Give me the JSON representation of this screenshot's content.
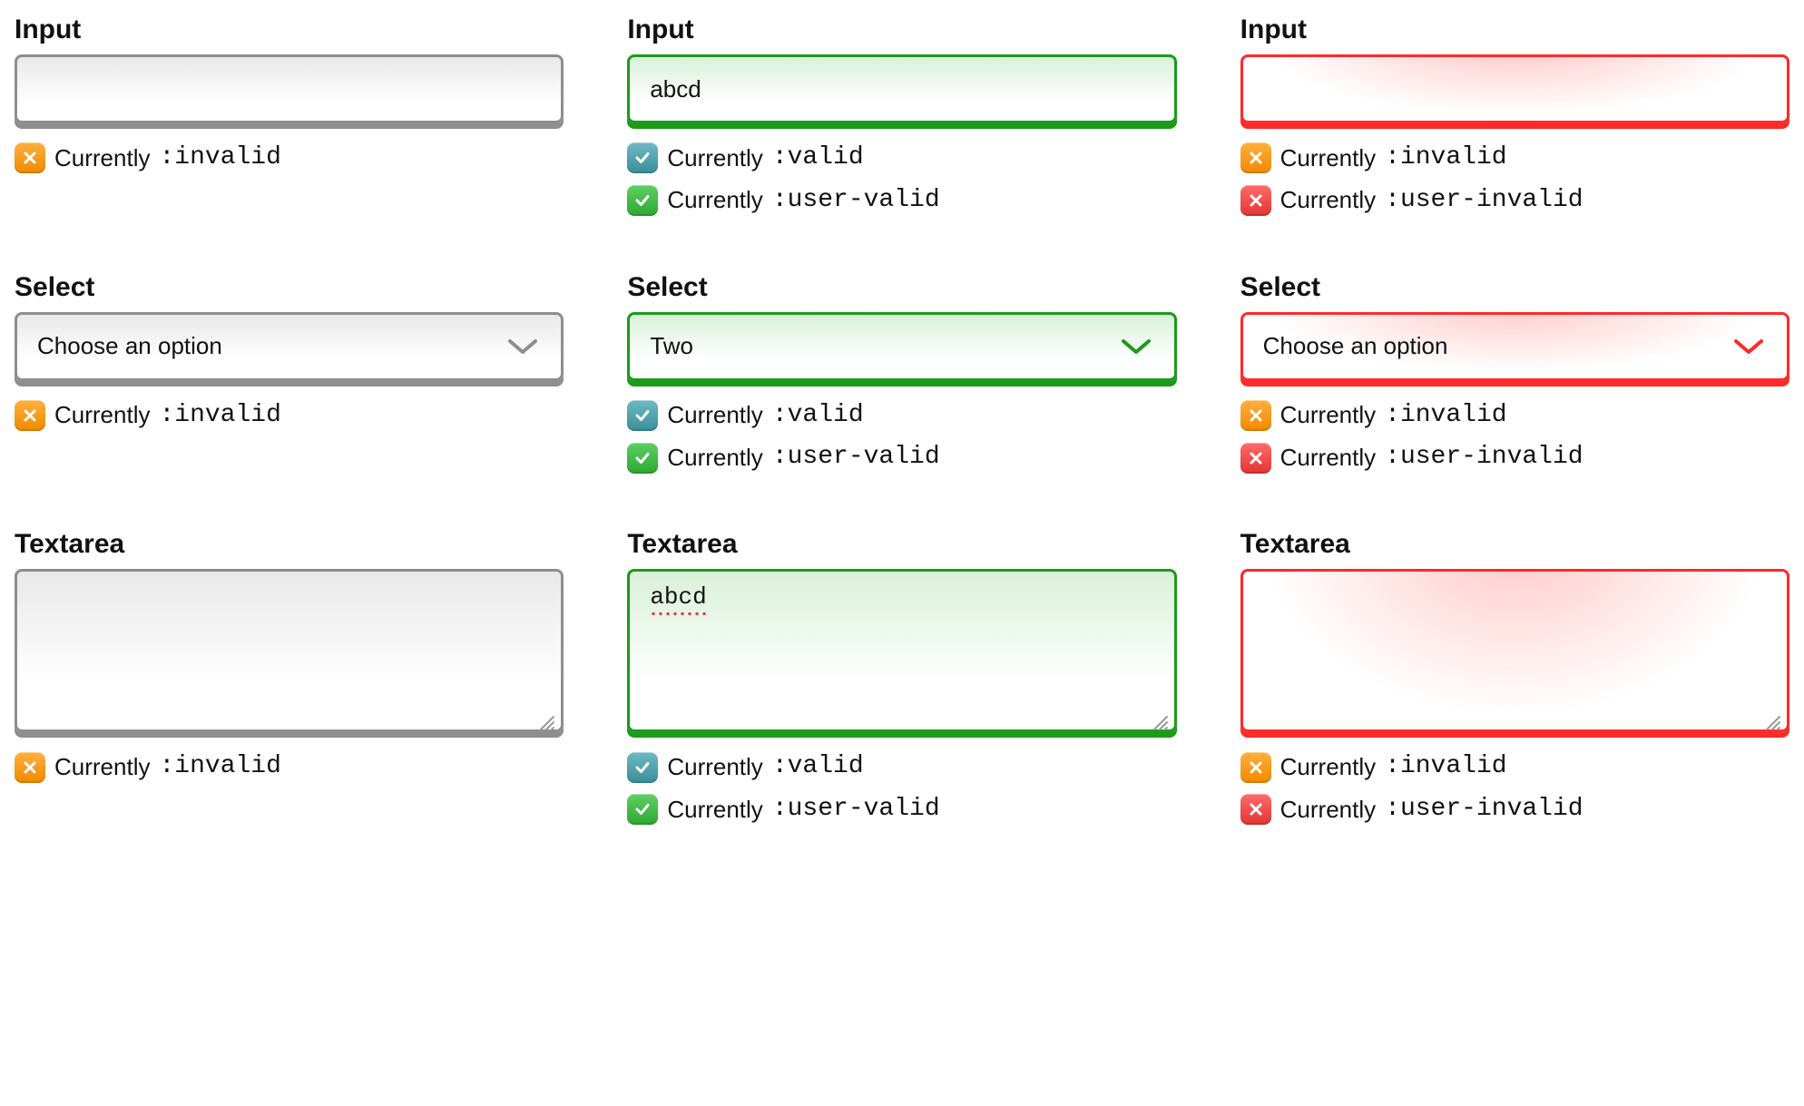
{
  "labels": {
    "input": "Input",
    "select": "Select",
    "textarea": "Textarea"
  },
  "status_prefix": "Currently",
  "pseudo": {
    "invalid": ":invalid",
    "valid": ":valid",
    "user_valid": ":user-valid",
    "user_invalid": ":user-invalid"
  },
  "icons": {
    "orange_x": "x-orange-icon",
    "teal_check": "check-teal-icon",
    "green_check": "check-green-icon",
    "red_x": "x-red-icon"
  },
  "colors": {
    "gray": "#8e8e8e",
    "green": "#1a9b1a",
    "red": "#ff2a2a"
  },
  "cells": [
    {
      "kind": "input",
      "tone": "gray",
      "value": "",
      "statuses": [
        {
          "icon": "orange_x",
          "pseudo": "invalid"
        }
      ]
    },
    {
      "kind": "input",
      "tone": "green",
      "value": "abcd",
      "statuses": [
        {
          "icon": "teal_check",
          "pseudo": "valid"
        },
        {
          "icon": "green_check",
          "pseudo": "user_valid"
        }
      ]
    },
    {
      "kind": "input",
      "tone": "red",
      "value": "",
      "statuses": [
        {
          "icon": "orange_x",
          "pseudo": "invalid"
        },
        {
          "icon": "red_x",
          "pseudo": "user_invalid"
        }
      ]
    },
    {
      "kind": "select",
      "tone": "gray",
      "value": "Choose an option",
      "statuses": [
        {
          "icon": "orange_x",
          "pseudo": "invalid"
        }
      ]
    },
    {
      "kind": "select",
      "tone": "green",
      "value": "Two",
      "statuses": [
        {
          "icon": "teal_check",
          "pseudo": "valid"
        },
        {
          "icon": "green_check",
          "pseudo": "user_valid"
        }
      ]
    },
    {
      "kind": "select",
      "tone": "red",
      "value": "Choose an option",
      "statuses": [
        {
          "icon": "orange_x",
          "pseudo": "invalid"
        },
        {
          "icon": "red_x",
          "pseudo": "user_invalid"
        }
      ]
    },
    {
      "kind": "textarea",
      "tone": "gray",
      "value": "",
      "statuses": [
        {
          "icon": "orange_x",
          "pseudo": "invalid"
        }
      ]
    },
    {
      "kind": "textarea",
      "tone": "green",
      "value": "abcd",
      "spellcheck_underline": true,
      "statuses": [
        {
          "icon": "teal_check",
          "pseudo": "valid"
        },
        {
          "icon": "green_check",
          "pseudo": "user_valid"
        }
      ]
    },
    {
      "kind": "textarea",
      "tone": "red",
      "value": "",
      "statuses": [
        {
          "icon": "orange_x",
          "pseudo": "invalid"
        },
        {
          "icon": "red_x",
          "pseudo": "user_invalid"
        }
      ]
    }
  ]
}
